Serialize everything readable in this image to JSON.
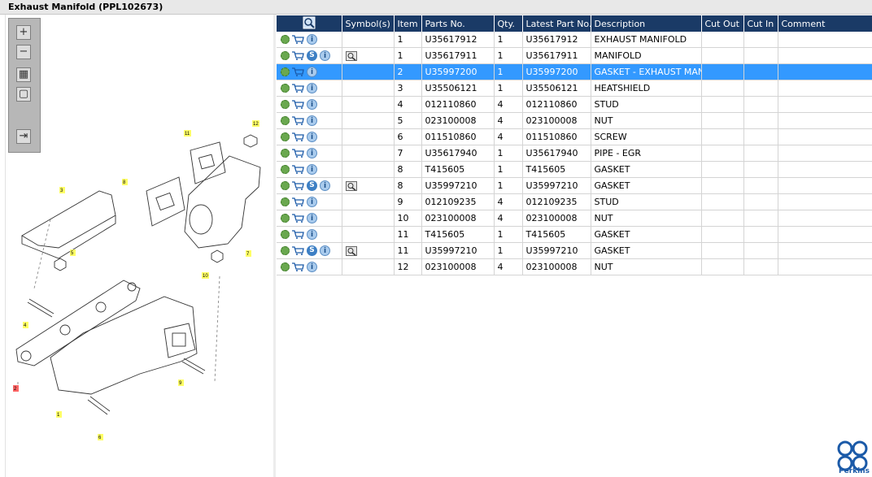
{
  "window": {
    "title": "Exhaust Manifold (PPL102673)"
  },
  "toolbar": {
    "buttons": [
      {
        "icon": "zoom-in-icon",
        "glyph": "+"
      },
      {
        "icon": "zoom-out-icon",
        "glyph": "−"
      },
      {
        "icon": "fit-page-icon",
        "glyph": "▦"
      },
      {
        "icon": "actual-size-icon",
        "glyph": "▢"
      },
      {
        "icon": "export-icon",
        "glyph": "⇥"
      }
    ]
  },
  "diagram": {
    "callouts": [
      "11",
      "12",
      "8",
      "3",
      "5",
      "10",
      "7",
      "4",
      "2",
      "9",
      "1",
      "6"
    ]
  },
  "table": {
    "columns": [
      "",
      "Symbol(s)",
      "Item",
      "Parts No.",
      "Qty.",
      "Latest Part No.",
      "Description",
      "Cut Out",
      "Cut In",
      "Comment"
    ],
    "selected_row": 2,
    "rows": [
      {
        "s": false,
        "sym": false,
        "item": "1",
        "part": "U35617912",
        "qty": "1",
        "latest": "U35617912",
        "desc": "EXHAUST MANIFOLD"
      },
      {
        "s": true,
        "sym": true,
        "item": "1",
        "part": "U35617911",
        "qty": "1",
        "latest": "U35617911",
        "desc": "MANIFOLD"
      },
      {
        "s": false,
        "sym": false,
        "item": "2",
        "part": "U35997200",
        "qty": "1",
        "latest": "U35997200",
        "desc": "GASKET - EXHAUST MANIFOLD"
      },
      {
        "s": false,
        "sym": false,
        "item": "3",
        "part": "U35506121",
        "qty": "1",
        "latest": "U35506121",
        "desc": "HEATSHIELD"
      },
      {
        "s": false,
        "sym": false,
        "item": "4",
        "part": "012110860",
        "qty": "4",
        "latest": "012110860",
        "desc": "STUD"
      },
      {
        "s": false,
        "sym": false,
        "item": "5",
        "part": "023100008",
        "qty": "4",
        "latest": "023100008",
        "desc": "NUT"
      },
      {
        "s": false,
        "sym": false,
        "item": "6",
        "part": "011510860",
        "qty": "4",
        "latest": "011510860",
        "desc": "SCREW"
      },
      {
        "s": false,
        "sym": false,
        "item": "7",
        "part": "U35617940",
        "qty": "1",
        "latest": "U35617940",
        "desc": "PIPE - EGR"
      },
      {
        "s": false,
        "sym": false,
        "item": "8",
        "part": "T415605",
        "qty": "1",
        "latest": "T415605",
        "desc": "GASKET"
      },
      {
        "s": true,
        "sym": true,
        "item": "8",
        "part": "U35997210",
        "qty": "1",
        "latest": "U35997210",
        "desc": "GASKET"
      },
      {
        "s": false,
        "sym": false,
        "item": "9",
        "part": "012109235",
        "qty": "4",
        "latest": "012109235",
        "desc": "STUD"
      },
      {
        "s": false,
        "sym": false,
        "item": "10",
        "part": "023100008",
        "qty": "4",
        "latest": "023100008",
        "desc": "NUT"
      },
      {
        "s": false,
        "sym": false,
        "item": "11",
        "part": "T415605",
        "qty": "1",
        "latest": "T415605",
        "desc": "GASKET"
      },
      {
        "s": true,
        "sym": true,
        "item": "11",
        "part": "U35997210",
        "qty": "1",
        "latest": "U35997210",
        "desc": "GASKET"
      },
      {
        "s": false,
        "sym": false,
        "item": "12",
        "part": "023100008",
        "qty": "4",
        "latest": "023100008",
        "desc": "NUT"
      }
    ]
  },
  "brand": {
    "name": "Perkins",
    "accent": "#1b5aa8",
    "header_color": "#1a3a66",
    "selection_color": "#3399ff"
  }
}
